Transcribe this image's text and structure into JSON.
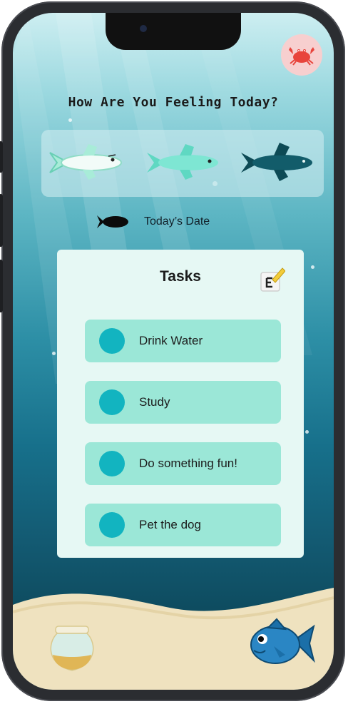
{
  "header": {
    "title": "How Are You Feeling Today?"
  },
  "moods": [
    {
      "name": "light-fish",
      "color": "#e9f7f4"
    },
    {
      "name": "aqua-fish",
      "color": "#6fe0cf"
    },
    {
      "name": "dark-fish",
      "color": "#0f5a67"
    }
  ],
  "date": {
    "label": "Today’s Date"
  },
  "tasks": {
    "title": "Tasks",
    "items": [
      {
        "label": "Drink Water"
      },
      {
        "label": "Study"
      },
      {
        "label": "Do something fun!"
      },
      {
        "label": "Pet the dog"
      }
    ]
  },
  "colors": {
    "task_item": "#9be7d7",
    "task_check": "#12b4c0",
    "card": "#e6f8f4",
    "crab_bg": "#f7cfcf",
    "sand": "#efe2bf"
  },
  "icons": {
    "profile": "crab-icon",
    "edit": "edit-pencil-icon",
    "date": "fish-silhouette-icon",
    "nav_left": "fishbowl-icon",
    "nav_right": "blue-fish-icon"
  }
}
